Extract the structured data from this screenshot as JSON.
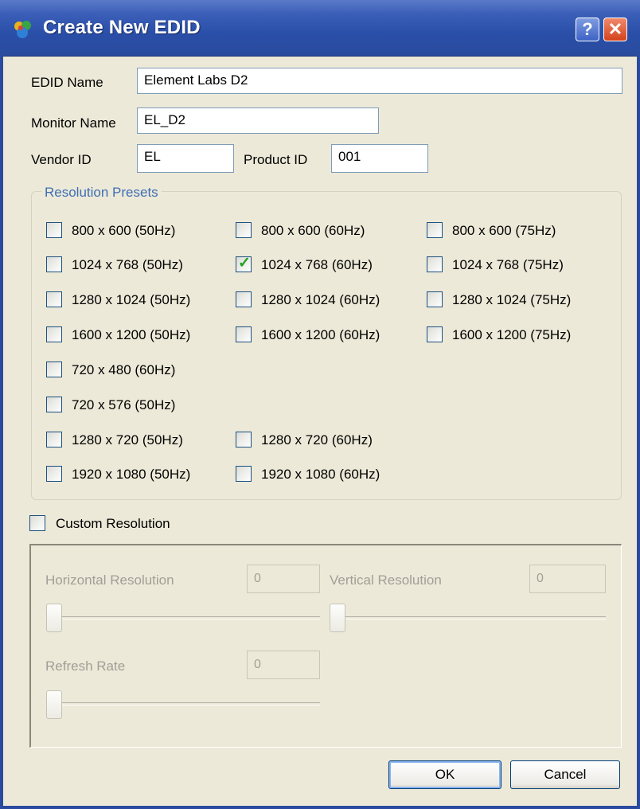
{
  "window": {
    "title": "Create New EDID",
    "help_glyph": "?",
    "close_glyph": "✕"
  },
  "fields": {
    "edid_name_label": "EDID Name",
    "edid_name_value": "Element Labs D2",
    "monitor_name_label": "Monitor Name",
    "monitor_name_value": "EL_D2",
    "vendor_id_label": "Vendor ID",
    "vendor_id_value": "EL",
    "product_id_label": "Product ID",
    "product_id_value": "001"
  },
  "presets": {
    "title": "Resolution Presets",
    "items": [
      {
        "label": "800 x 600 (50Hz)",
        "checked": false
      },
      {
        "label": "800 x 600 (60Hz)",
        "checked": false
      },
      {
        "label": "800 x 600 (75Hz)",
        "checked": false
      },
      {
        "label": "1024 x 768 (50Hz)",
        "checked": false
      },
      {
        "label": "1024 x 768 (60Hz)",
        "checked": true
      },
      {
        "label": "1024 x 768 (75Hz)",
        "checked": false
      },
      {
        "label": "1280 x 1024 (50Hz)",
        "checked": false
      },
      {
        "label": "1280 x 1024 (60Hz)",
        "checked": false
      },
      {
        "label": "1280 x 1024 (75Hz)",
        "checked": false
      },
      {
        "label": "1600 x 1200 (50Hz)",
        "checked": false
      },
      {
        "label": "1600 x 1200  (60Hz)",
        "checked": false
      },
      {
        "label": "1600 x 1200  (75Hz)",
        "checked": false
      },
      {
        "label": "720 x 480 (60Hz)",
        "checked": false
      },
      {
        "label": "720 x 576 (50Hz)",
        "checked": false
      },
      {
        "label": "1280 x 720 (50Hz)",
        "checked": false
      },
      {
        "label": "1280 x 720 (60Hz)",
        "checked": false
      },
      {
        "label": "1920 x 1080 (50Hz)",
        "checked": false
      },
      {
        "label": "1920 x 1080 (60Hz)",
        "checked": false
      }
    ]
  },
  "custom": {
    "checkbox_label": "Custom Resolution",
    "checked": false,
    "horizontal_label": "Horizontal Resolution",
    "horizontal_value": "0",
    "vertical_label": "Vertical Resolution",
    "vertical_value": "0",
    "refresh_label": "Refresh Rate",
    "refresh_value": "0"
  },
  "buttons": {
    "ok": "OK",
    "cancel": "Cancel"
  }
}
